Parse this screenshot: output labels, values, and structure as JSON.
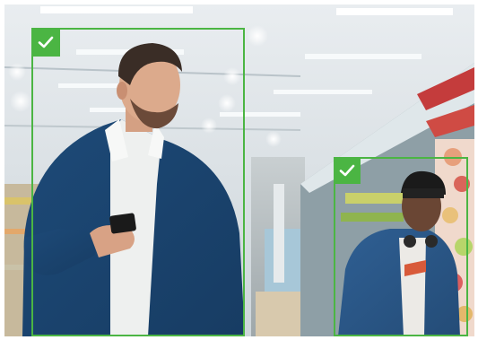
{
  "scene": {
    "description_icon": "supermarket-shoppers-photo",
    "detections": [
      {
        "name": "person-1",
        "status": "verified",
        "icon": "check-icon",
        "color": "#4bb543"
      },
      {
        "name": "person-2",
        "status": "verified",
        "icon": "check-icon",
        "color": "#4bb543"
      }
    ]
  }
}
